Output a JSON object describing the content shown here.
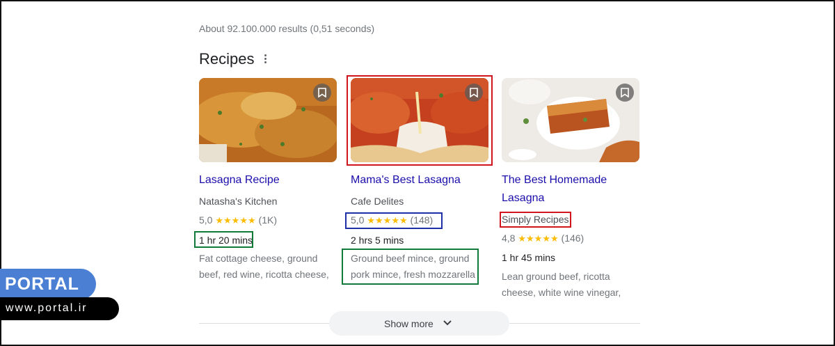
{
  "search": {
    "result_stats": "About 92.100.000 results (0,51 seconds)"
  },
  "recipes": {
    "section_title": "Recipes",
    "more_icon": "more-vert-icon",
    "cards": [
      {
        "title": "Lasagna Recipe",
        "source": "Natasha's Kitchen",
        "rating_value": "5,0",
        "stars": "★★★★★",
        "review_count": "(1K)",
        "time": "1 hr 20 mins",
        "ingredients": "Fat cottage cheese, ground beef, red wine, ricotta cheese,",
        "bookmark_icon": "bookmark-icon"
      },
      {
        "title": "Mama's Best Lasagna",
        "source": "Cafe Delites",
        "rating_value": "5,0",
        "stars": "★★★★★",
        "review_count": "(148)",
        "time": "2 hrs 5 mins",
        "ingredients": "Ground beef mince, ground pork mince, fresh mozzarella",
        "bookmark_icon": "bookmark-icon"
      },
      {
        "title": "The Best Homemade Lasagna",
        "source": "Simply Recipes",
        "rating_value": "4,8",
        "stars": "★★★★★",
        "review_count": "(146)",
        "time": "1 hr 45 mins",
        "ingredients": "Lean ground beef, ricotta cheese, white wine vinegar,",
        "bookmark_icon": "bookmark-icon"
      }
    ],
    "show_more_label": "Show more",
    "show_more_icon": "chevron-down-icon"
  },
  "watermark": {
    "brand": "PORTAL",
    "url": "www.portal.ir"
  },
  "colors": {
    "link": "#1a0dab",
    "star": "#fbbc04",
    "highlight_red": "#d0151c",
    "highlight_blue": "#1f2fa8",
    "highlight_green": "#0f7a3a",
    "brand_blue": "#4a7fd4"
  }
}
